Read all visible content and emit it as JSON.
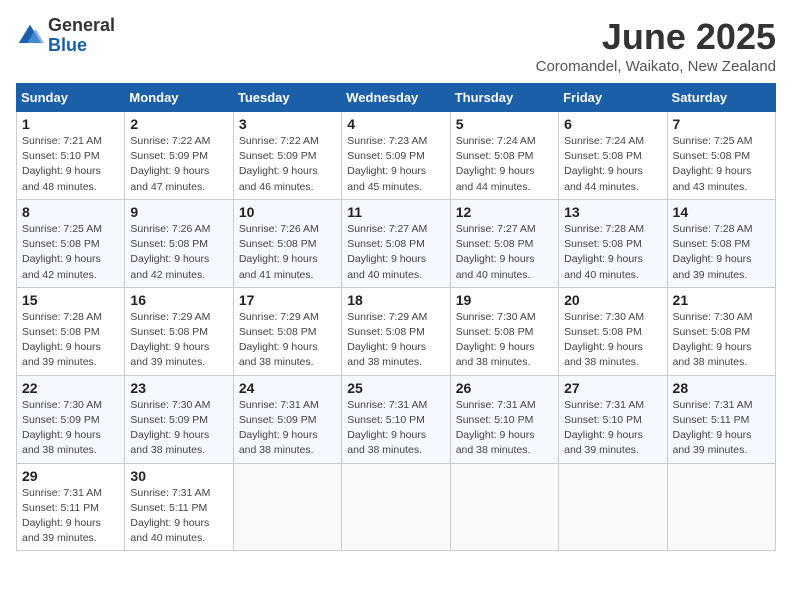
{
  "logo": {
    "general": "General",
    "blue": "Blue"
  },
  "title": "June 2025",
  "location": "Coromandel, Waikato, New Zealand",
  "weekdays": [
    "Sunday",
    "Monday",
    "Tuesday",
    "Wednesday",
    "Thursday",
    "Friday",
    "Saturday"
  ],
  "weeks": [
    [
      {
        "day": "1",
        "info": "Sunrise: 7:21 AM\nSunset: 5:10 PM\nDaylight: 9 hours\nand 48 minutes."
      },
      {
        "day": "2",
        "info": "Sunrise: 7:22 AM\nSunset: 5:09 PM\nDaylight: 9 hours\nand 47 minutes."
      },
      {
        "day": "3",
        "info": "Sunrise: 7:22 AM\nSunset: 5:09 PM\nDaylight: 9 hours\nand 46 minutes."
      },
      {
        "day": "4",
        "info": "Sunrise: 7:23 AM\nSunset: 5:09 PM\nDaylight: 9 hours\nand 45 minutes."
      },
      {
        "day": "5",
        "info": "Sunrise: 7:24 AM\nSunset: 5:08 PM\nDaylight: 9 hours\nand 44 minutes."
      },
      {
        "day": "6",
        "info": "Sunrise: 7:24 AM\nSunset: 5:08 PM\nDaylight: 9 hours\nand 44 minutes."
      },
      {
        "day": "7",
        "info": "Sunrise: 7:25 AM\nSunset: 5:08 PM\nDaylight: 9 hours\nand 43 minutes."
      }
    ],
    [
      {
        "day": "8",
        "info": "Sunrise: 7:25 AM\nSunset: 5:08 PM\nDaylight: 9 hours\nand 42 minutes."
      },
      {
        "day": "9",
        "info": "Sunrise: 7:26 AM\nSunset: 5:08 PM\nDaylight: 9 hours\nand 42 minutes."
      },
      {
        "day": "10",
        "info": "Sunrise: 7:26 AM\nSunset: 5:08 PM\nDaylight: 9 hours\nand 41 minutes."
      },
      {
        "day": "11",
        "info": "Sunrise: 7:27 AM\nSunset: 5:08 PM\nDaylight: 9 hours\nand 40 minutes."
      },
      {
        "day": "12",
        "info": "Sunrise: 7:27 AM\nSunset: 5:08 PM\nDaylight: 9 hours\nand 40 minutes."
      },
      {
        "day": "13",
        "info": "Sunrise: 7:28 AM\nSunset: 5:08 PM\nDaylight: 9 hours\nand 40 minutes."
      },
      {
        "day": "14",
        "info": "Sunrise: 7:28 AM\nSunset: 5:08 PM\nDaylight: 9 hours\nand 39 minutes."
      }
    ],
    [
      {
        "day": "15",
        "info": "Sunrise: 7:28 AM\nSunset: 5:08 PM\nDaylight: 9 hours\nand 39 minutes."
      },
      {
        "day": "16",
        "info": "Sunrise: 7:29 AM\nSunset: 5:08 PM\nDaylight: 9 hours\nand 39 minutes."
      },
      {
        "day": "17",
        "info": "Sunrise: 7:29 AM\nSunset: 5:08 PM\nDaylight: 9 hours\nand 38 minutes."
      },
      {
        "day": "18",
        "info": "Sunrise: 7:29 AM\nSunset: 5:08 PM\nDaylight: 9 hours\nand 38 minutes."
      },
      {
        "day": "19",
        "info": "Sunrise: 7:30 AM\nSunset: 5:08 PM\nDaylight: 9 hours\nand 38 minutes."
      },
      {
        "day": "20",
        "info": "Sunrise: 7:30 AM\nSunset: 5:08 PM\nDaylight: 9 hours\nand 38 minutes."
      },
      {
        "day": "21",
        "info": "Sunrise: 7:30 AM\nSunset: 5:08 PM\nDaylight: 9 hours\nand 38 minutes."
      }
    ],
    [
      {
        "day": "22",
        "info": "Sunrise: 7:30 AM\nSunset: 5:09 PM\nDaylight: 9 hours\nand 38 minutes."
      },
      {
        "day": "23",
        "info": "Sunrise: 7:30 AM\nSunset: 5:09 PM\nDaylight: 9 hours\nand 38 minutes."
      },
      {
        "day": "24",
        "info": "Sunrise: 7:31 AM\nSunset: 5:09 PM\nDaylight: 9 hours\nand 38 minutes."
      },
      {
        "day": "25",
        "info": "Sunrise: 7:31 AM\nSunset: 5:10 PM\nDaylight: 9 hours\nand 38 minutes."
      },
      {
        "day": "26",
        "info": "Sunrise: 7:31 AM\nSunset: 5:10 PM\nDaylight: 9 hours\nand 38 minutes."
      },
      {
        "day": "27",
        "info": "Sunrise: 7:31 AM\nSunset: 5:10 PM\nDaylight: 9 hours\nand 39 minutes."
      },
      {
        "day": "28",
        "info": "Sunrise: 7:31 AM\nSunset: 5:11 PM\nDaylight: 9 hours\nand 39 minutes."
      }
    ],
    [
      {
        "day": "29",
        "info": "Sunrise: 7:31 AM\nSunset: 5:11 PM\nDaylight: 9 hours\nand 39 minutes."
      },
      {
        "day": "30",
        "info": "Sunrise: 7:31 AM\nSunset: 5:11 PM\nDaylight: 9 hours\nand 40 minutes."
      },
      {
        "day": "",
        "info": ""
      },
      {
        "day": "",
        "info": ""
      },
      {
        "day": "",
        "info": ""
      },
      {
        "day": "",
        "info": ""
      },
      {
        "day": "",
        "info": ""
      }
    ]
  ]
}
